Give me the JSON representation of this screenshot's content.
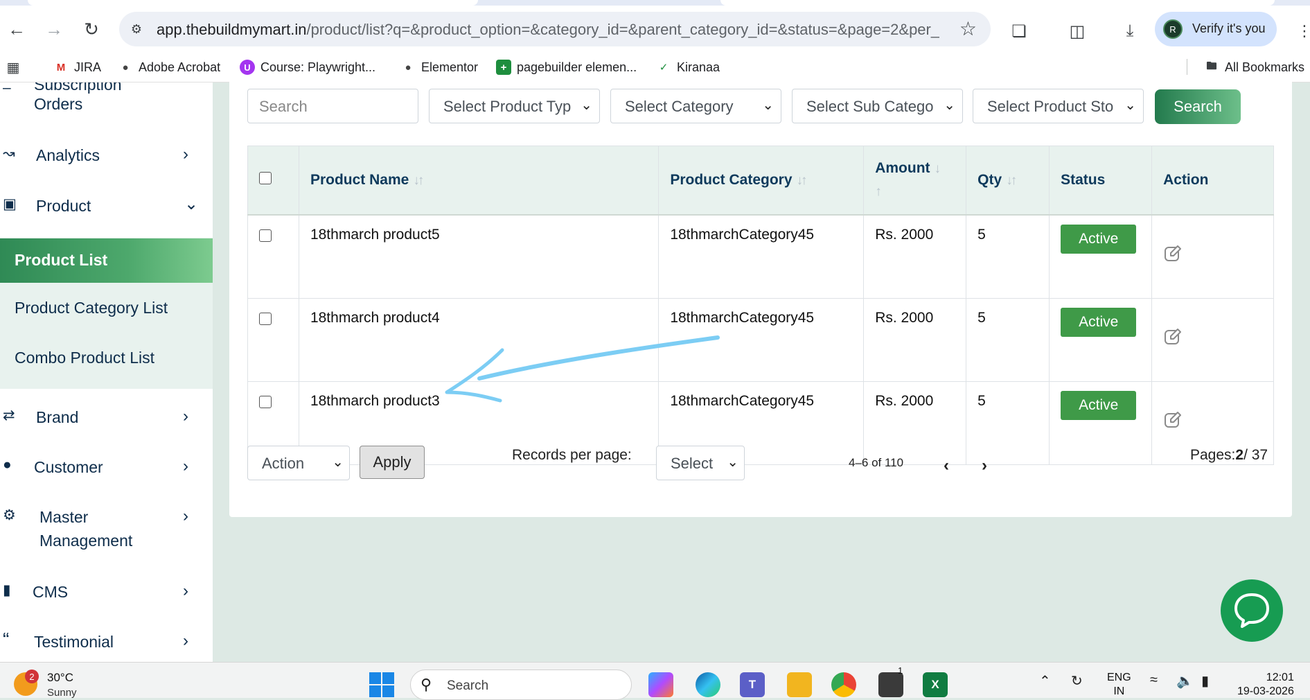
{
  "browser": {
    "url_host": "app.thebuildmymart.in",
    "url_path": "/product/list?q=&product_option=&category_id=&parent_category_id=&status=&page=2&per_...",
    "verify_label": "Verify it's you",
    "avatar_letter": "R",
    "bookmarks": [
      {
        "label": "JIRA",
        "icon": "gmail-icon"
      },
      {
        "label": "Adobe Acrobat",
        "icon": "globe-icon"
      },
      {
        "label": "Course: Playwright...",
        "icon": "udemy-icon"
      },
      {
        "label": "Elementor",
        "icon": "globe-icon"
      },
      {
        "label": "pagebuilder elemen...",
        "icon": "sheets-icon"
      },
      {
        "label": "Kiranaa",
        "icon": "check-circle-icon"
      }
    ],
    "all_bookmarks_label": "All Bookmarks"
  },
  "sidebar": {
    "subscription_orders": "Subscription Orders",
    "subscription_line1": "Subscription",
    "subscription_line2": "Orders",
    "items": [
      {
        "label": "Analytics",
        "icon": "chart-line-icon"
      },
      {
        "label": "Product",
        "icon": "archive-box-icon"
      },
      {
        "label": "Brand",
        "icon": "shuffle-icon"
      },
      {
        "label": "Customer",
        "icon": "user-icon"
      },
      {
        "label": "Master",
        "label2": "Management",
        "icon": "user-cog-icon"
      },
      {
        "label": "CMS",
        "icon": "document-icon"
      },
      {
        "label": "Testimonial",
        "icon": "quote-icon"
      }
    ],
    "product_submenu": [
      "Product List",
      "Product Category List",
      "Combo Product List"
    ],
    "active_submenu": "Product List"
  },
  "filters": {
    "search_placeholder": "Search",
    "product_type": "Select Product Typ",
    "category": "Select Category",
    "sub_category": "Select Sub Catego",
    "product_status": "Select Product Sto",
    "search_button": "Search"
  },
  "table": {
    "headers": {
      "product_name": "Product Name",
      "product_category": "Product Category",
      "amount": "Amount",
      "qty": "Qty",
      "status": "Status",
      "action": "Action"
    },
    "rows": [
      {
        "name": "18thmarch product5",
        "category": "18thmarchCategory45",
        "amount": "Rs. 2000",
        "qty": "5",
        "status": "Active"
      },
      {
        "name": "18thmarch product4",
        "category": "18thmarchCategory45",
        "amount": "Rs. 2000",
        "qty": "5",
        "status": "Active"
      },
      {
        "name": "18thmarch product3",
        "category": "18thmarchCategory45",
        "amount": "Rs. 2000",
        "qty": "5",
        "status": "Active"
      }
    ]
  },
  "footer": {
    "bulk_action": "Action",
    "apply_button": "Apply",
    "records_per_page_label": "Records per page:",
    "records_per_page_value": "Select",
    "range": "4–6 of 110",
    "pages_prefix": "Pages:",
    "current_page": "2",
    "total_pages": "/ 37"
  },
  "taskbar": {
    "weather_temp": "30°C",
    "weather_condition": "Sunny",
    "notification_count": "2",
    "search_placeholder": "Search",
    "lang_line1": "ENG",
    "lang_line2": "IN",
    "time": "12:01",
    "date": "19-03-2026",
    "store_badge": "1"
  },
  "colors": {
    "brand_green": "#3f9a48",
    "sidebar_text": "#0e2d4b",
    "header_bg": "#e8f2ee",
    "annotation_arrow": "#7ccdf4"
  }
}
